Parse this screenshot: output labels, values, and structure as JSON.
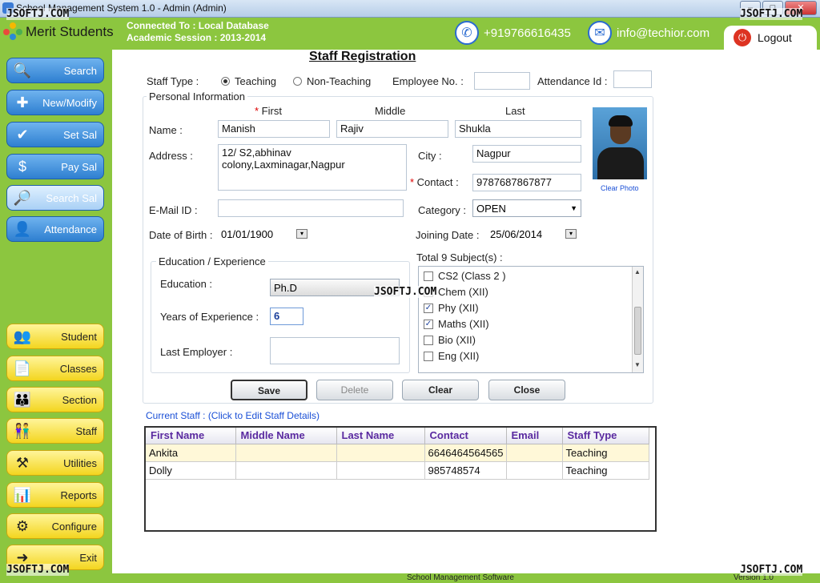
{
  "window": {
    "title": "School Management System 1.0  -  Admin (Admin)"
  },
  "watermark": "JSOFTJ.COM",
  "header": {
    "app_name": "Merit Students",
    "connection": "Connected To : Local Database",
    "session": "Academic Session : 2013-2014",
    "phone": "+919766616435",
    "email": "info@techior.com",
    "logout": "Logout"
  },
  "sidebar": {
    "top": [
      {
        "label": "Search",
        "icon": "magnifier-icon"
      },
      {
        "label": "New/Modify",
        "icon": "add-document-icon"
      },
      {
        "label": "Set Sal",
        "icon": "money-settings-icon"
      },
      {
        "label": "Pay Sal",
        "icon": "money-bag-icon"
      },
      {
        "label": "Search Sal",
        "icon": "search-money-icon"
      },
      {
        "label": "Attendance",
        "icon": "person-icon"
      }
    ],
    "bottom": [
      {
        "label": "Student",
        "icon": "students-icon"
      },
      {
        "label": "Classes",
        "icon": "document-icon"
      },
      {
        "label": "Section",
        "icon": "section-icon"
      },
      {
        "label": "Staff",
        "icon": "staff-icon"
      },
      {
        "label": "Utilities",
        "icon": "utilities-icon"
      },
      {
        "label": "Reports",
        "icon": "reports-icon"
      },
      {
        "label": "Configure",
        "icon": "gear-icon"
      },
      {
        "label": "Exit",
        "icon": "exit-icon"
      }
    ]
  },
  "form": {
    "title": "Staff Registration",
    "staff_type_label": "Staff Type :",
    "teaching": "Teaching",
    "non_teaching": "Non-Teaching",
    "employee_no_label": "Employee No. :",
    "attendance_id_label": "Attendance Id :",
    "personal_info": "Personal Information",
    "first_hdr": "First",
    "middle_hdr": "Middle",
    "last_hdr": "Last",
    "name_label": "Name :",
    "first": "Manish",
    "middle": "Rajiv",
    "last": "Shukla",
    "address_label": "Address :",
    "address_line1": "12/ S2,abhinav",
    "address_line2": "colony,Laxminagar,Nagpur",
    "city_label": "City :",
    "city": "Nagpur",
    "contact_label": "Contact :",
    "contact": "9787687867877",
    "clear_photo": "Clear Photo",
    "email_label": "E-Mail ID :",
    "email": "",
    "category_label": "Category :",
    "category": "OPEN",
    "dob_label": "Date of Birth :",
    "dob": "01/01/1900",
    "joining_label": "Joining Date :",
    "joining": "25/06/2014",
    "edu_group": "Education / Experience",
    "education_label": "Education :",
    "education": "Ph.D",
    "years_label": "Years of Experience :",
    "years": "6",
    "last_employer_label": "Last Employer :",
    "last_employer": "",
    "subjects_label": "Total 9 Subject(s) :",
    "subjects": [
      {
        "name": "CS2 (Class 2 )",
        "checked": false
      },
      {
        "name": "Chem (XII)",
        "checked": false
      },
      {
        "name": "Phy (XII)",
        "checked": true
      },
      {
        "name": "Maths (XII)",
        "checked": true
      },
      {
        "name": "Bio (XII)",
        "checked": false
      },
      {
        "name": "Eng (XII)",
        "checked": false
      }
    ]
  },
  "buttons": {
    "save": "Save",
    "delete": "Delete",
    "clear": "Clear",
    "close": "Close"
  },
  "staff_table": {
    "caption": "Current Staff : (Click to Edit Staff Details)",
    "headers": [
      "First Name",
      "Middle Name",
      "Last Name",
      "Contact",
      "Email",
      "Staff Type"
    ],
    "rows": [
      [
        "Ankita",
        "",
        "",
        "6646464564565",
        "",
        "Teaching"
      ],
      [
        "Dolly",
        "",
        "",
        "985748574",
        "",
        "Teaching"
      ]
    ]
  },
  "footer": {
    "center": "School Management Software",
    "version": "Version 1.0"
  }
}
